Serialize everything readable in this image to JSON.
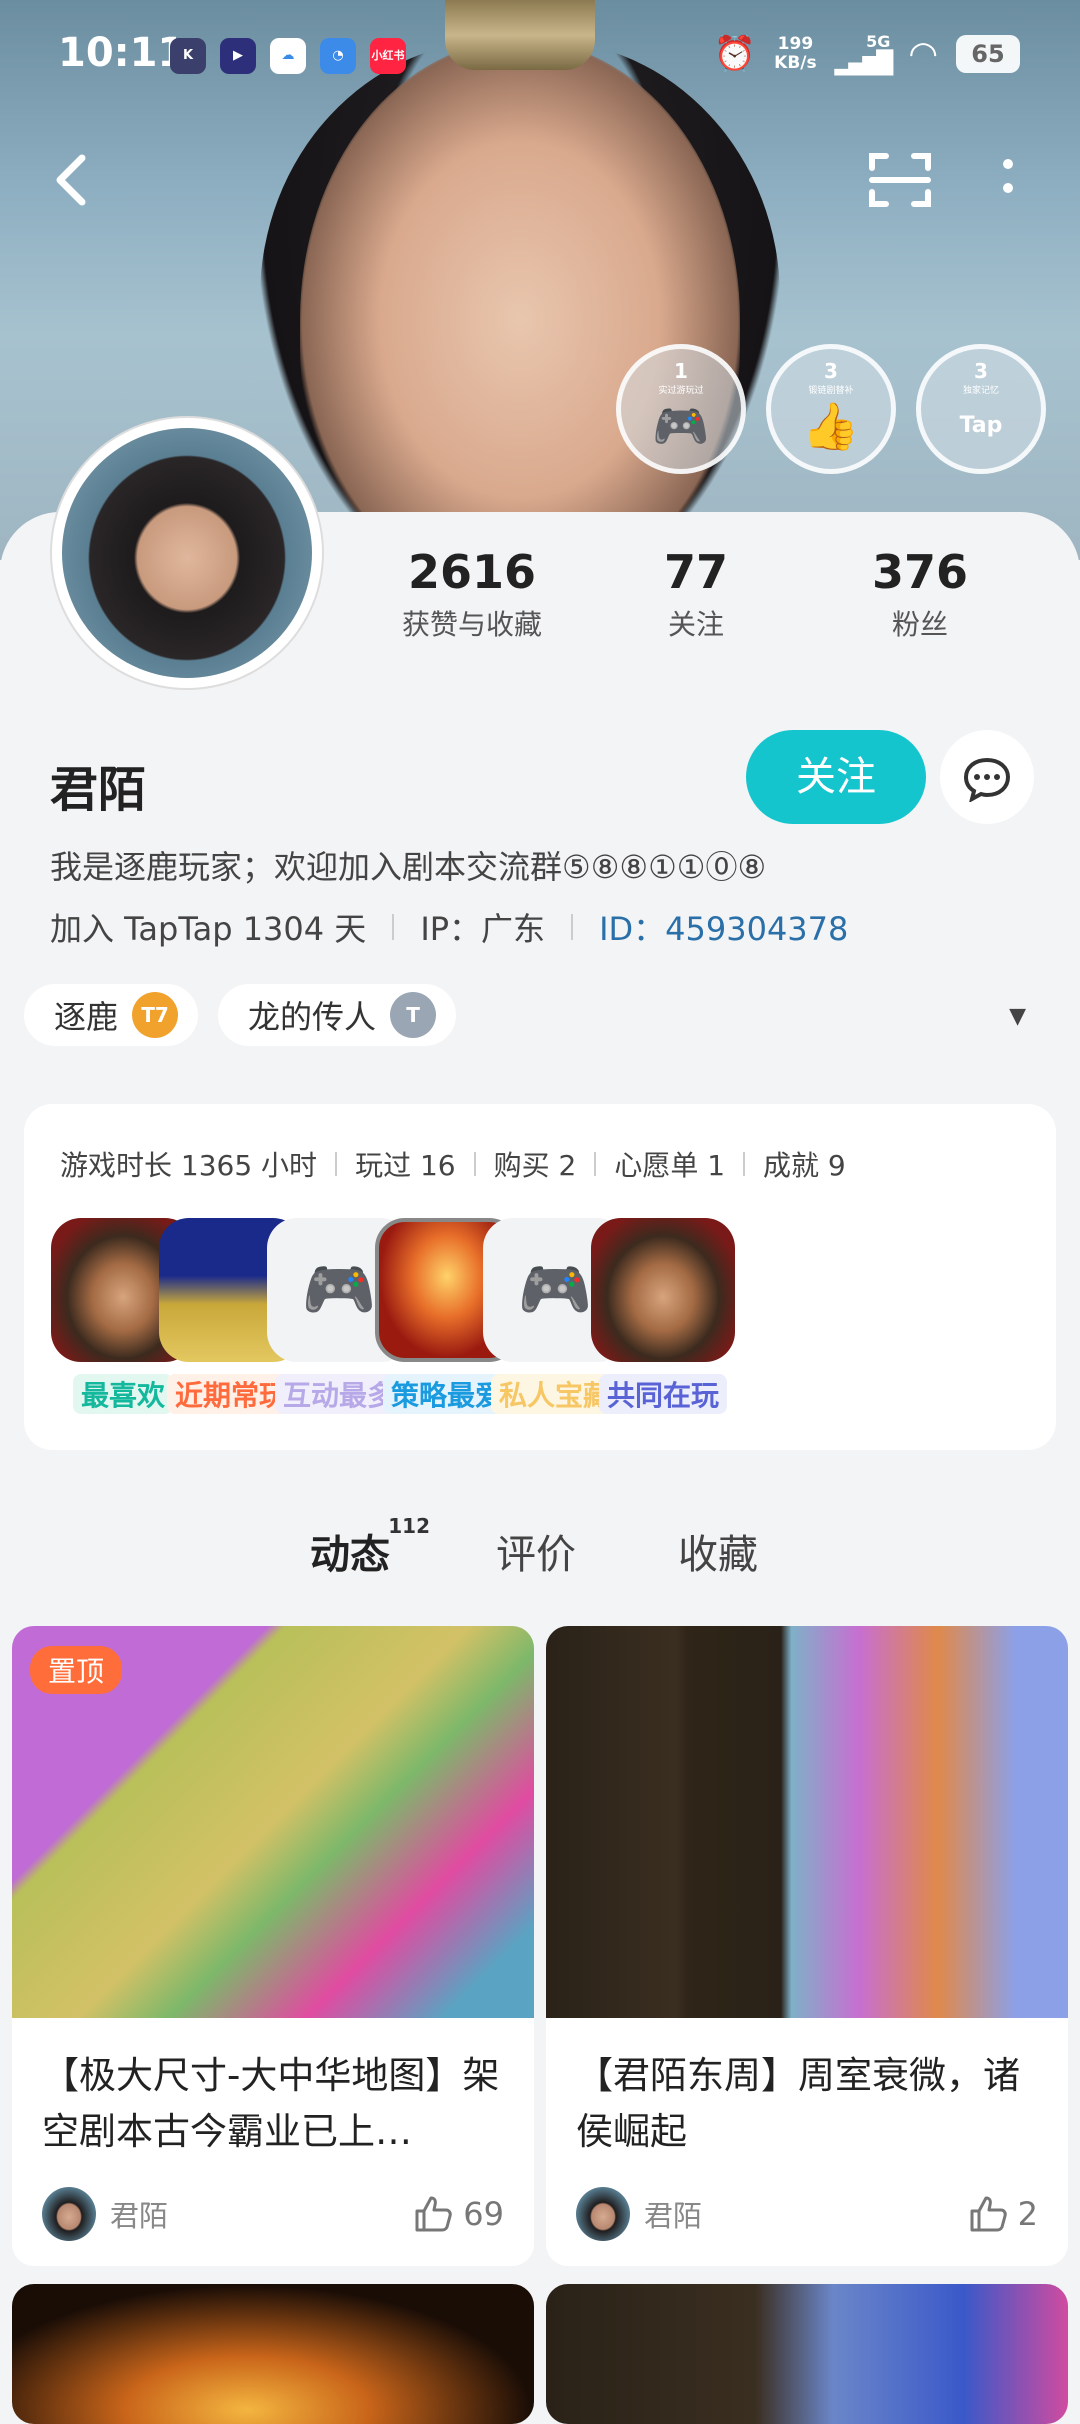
{
  "status_bar": {
    "time": "10:11",
    "apps": [
      {
        "name": "k-app-icon",
        "label": "K",
        "color": "#5a4cc2"
      },
      {
        "name": "play-app-icon",
        "label": "▶",
        "color": "#3b3ad6"
      },
      {
        "name": "cloud-app-icon",
        "label": "☁",
        "color": "#ffffff"
      },
      {
        "name": "bag-app-icon",
        "label": "◔",
        "color": "#f3a928"
      },
      {
        "name": "xiaohongshu-app-icon",
        "label": "小红书",
        "color": "#ff2442"
      }
    ],
    "net_speed_value": "199",
    "net_speed_unit": "KB/s",
    "network": "5G",
    "battery": "65"
  },
  "badges": [
    {
      "num": "1",
      "label": "实过游玩过"
    },
    {
      "num": "3",
      "label": "锻链剧替补"
    },
    {
      "num": "3",
      "label": "独家记忆"
    }
  ],
  "profile": {
    "likes_count": "2616",
    "likes_label": "获赞与收藏",
    "following_count": "77",
    "following_label": "关注",
    "followers_count": "376",
    "followers_label": "粉丝",
    "name": "君陌",
    "follow_label": "关注",
    "bio": "我是逐鹿玩家；欢迎加入剧本交流群⑤⑧⑧①①⓪⑧",
    "joined": "加入 TapTap 1304 天",
    "ip": "IP：广东",
    "id": "ID：459304378"
  },
  "tags": [
    {
      "label": "逐鹿",
      "badge": "T7",
      "badge_color": "#f0a22c"
    },
    {
      "label": "龙的传人",
      "badge": "T",
      "badge_color": "#9aa6b3"
    }
  ],
  "games": {
    "stats": [
      "游戏时长 1365 小时",
      "玩过 16",
      "购买 2",
      "心愿单 1",
      "成就 9"
    ],
    "items": [
      {
        "label": "最喜欢",
        "color": "#14b89c",
        "bg": "#e3f7f1"
      },
      {
        "label": "近期常玩",
        "color": "#ff6b3c",
        "bg": "#fff0e8"
      },
      {
        "label": "互动最多",
        "color": "#b7a8e8",
        "bg": "#f2effc"
      },
      {
        "label": "策略最爱",
        "color": "#1a9be0",
        "bg": "#e4f3fc"
      },
      {
        "label": "私人宝藏",
        "color": "#f7c766",
        "bg": "#fdf6e3"
      },
      {
        "label": "共同在玩",
        "color": "#5a63d6",
        "bg": "#eceefb"
      }
    ]
  },
  "tabs": [
    {
      "label": "动态",
      "count": "112"
    },
    {
      "label": "评价"
    },
    {
      "label": "收藏"
    }
  ],
  "posts": [
    {
      "pinned": "置顶",
      "title": "【极大尺寸-大中华地图】架空剧本古今霸业已上…",
      "author": "君陌",
      "likes": "69"
    },
    {
      "title": "【君陌东周】周室衰微，诸侯崛起",
      "author": "君陌",
      "likes": "2"
    }
  ]
}
